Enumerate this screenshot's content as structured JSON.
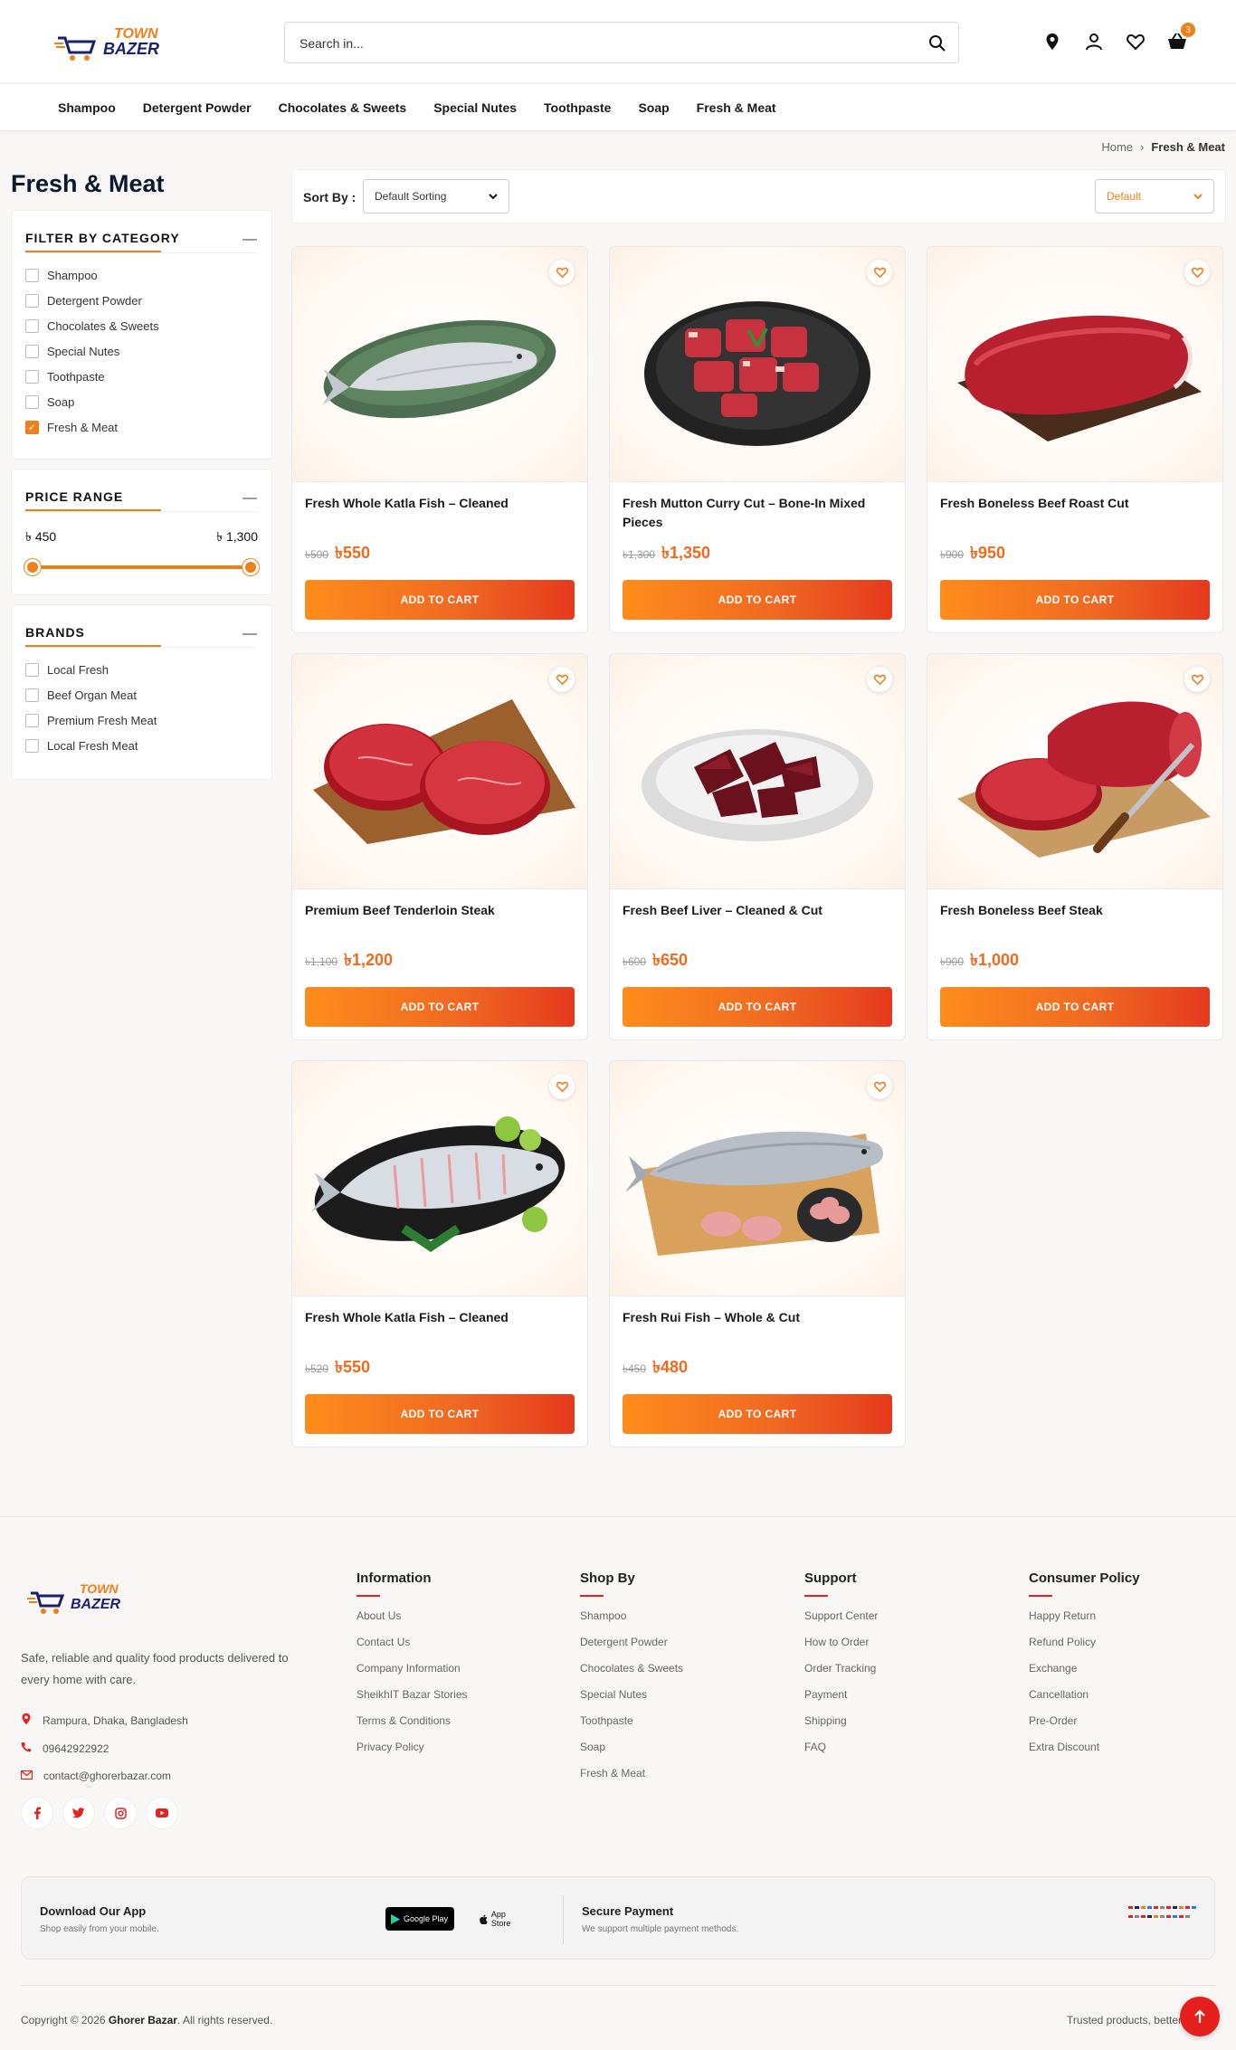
{
  "brand": {
    "line1": "TOWN",
    "line2": "BAZER",
    "accent": "#f07f1a",
    "ink": "#1b1f6e"
  },
  "header": {
    "search_placeholder": "Search in...",
    "cart_count": "3",
    "icons": [
      "location-icon",
      "user-icon",
      "heart-icon",
      "cart-icon"
    ]
  },
  "nav": {
    "categories": [
      "Shampoo",
      "Detergent Powder",
      "Chocolates & Sweets",
      "Special Nutes",
      "Toothpaste",
      "Soap",
      "Fresh & Meat"
    ]
  },
  "breadcrumb": {
    "home": "Home",
    "sep": "›",
    "current": "Fresh & Meat"
  },
  "page": {
    "title": "Fresh & Meat"
  },
  "filters": {
    "category_title": "FILTER BY CATEGORY",
    "categories": [
      {
        "label": "Shampoo",
        "checked": false
      },
      {
        "label": "Detergent Powder",
        "checked": false
      },
      {
        "label": "Chocolates & Sweets",
        "checked": false
      },
      {
        "label": "Special Nutes",
        "checked": false
      },
      {
        "label": "Toothpaste",
        "checked": false
      },
      {
        "label": "Soap",
        "checked": false
      },
      {
        "label": "Fresh & Meat",
        "checked": true
      }
    ],
    "price_title": "PRICE RANGE",
    "price_min": "৳ 450",
    "price_max": "৳ 1,300",
    "brands_title": "BRANDS",
    "brands": [
      {
        "label": "Local Fresh",
        "checked": false
      },
      {
        "label": "Beef Organ Meat",
        "checked": false
      },
      {
        "label": "Premium Fresh Meat",
        "checked": false
      },
      {
        "label": "Local Fresh Meat",
        "checked": false
      }
    ]
  },
  "toolbar": {
    "sort_label": "Sort By :",
    "sort_value": "Default Sorting",
    "view_value": "Default"
  },
  "products": [
    {
      "name": "Fresh Whole Katla Fish – Cleaned",
      "old": "৳500",
      "price": "৳550",
      "cta": "ADD TO CART",
      "kind": "fish-plate"
    },
    {
      "name": "Fresh Mutton Curry Cut – Bone-In Mixed Pieces",
      "old": "৳1,300",
      "price": "৳1,350",
      "cta": "ADD TO CART",
      "kind": "mutton"
    },
    {
      "name": "Fresh Boneless Beef Roast Cut",
      "old": "৳900",
      "price": "৳950",
      "cta": "ADD TO CART",
      "kind": "roast"
    },
    {
      "name": "Premium Beef Tenderloin Steak",
      "old": "৳1,100",
      "price": "৳1,200",
      "cta": "ADD TO CART",
      "kind": "steaks"
    },
    {
      "name": "Fresh Beef Liver – Cleaned & Cut",
      "old": "৳600",
      "price": "৳650",
      "cta": "ADD TO CART",
      "kind": "liver"
    },
    {
      "name": "Fresh Boneless Beef Steak",
      "old": "৳900",
      "price": "৳1,000",
      "cta": "ADD TO CART",
      "kind": "steak-knife"
    },
    {
      "name": "Fresh Whole Katla Fish – Cleaned",
      "old": "৳520",
      "price": "৳550",
      "cta": "ADD TO CART",
      "kind": "fish-black"
    },
    {
      "name": "Fresh Rui Fish – Whole & Cut",
      "old": "৳450",
      "price": "৳480",
      "cta": "ADD TO CART",
      "kind": "fish-board"
    }
  ],
  "footer": {
    "description": "Safe, reliable and quality food products delivered to every home with care.",
    "address": "Rampura, Dhaka, Bangladesh",
    "phone": "09642922922",
    "email": "contact@ghorerbazar.com",
    "socials": [
      "facebook-icon",
      "twitter-icon",
      "instagram-icon",
      "youtube-icon"
    ],
    "columns": [
      {
        "title": "Information",
        "links": [
          "About Us",
          "Contact Us",
          "Company Information",
          "SheikhIT Bazar Stories",
          "Terms & Conditions",
          "Privacy Policy"
        ]
      },
      {
        "title": "Shop By",
        "links": [
          "Shampoo",
          "Detergent Powder",
          "Chocolates & Sweets",
          "Special Nutes",
          "Toothpaste",
          "Soap",
          "Fresh & Meat"
        ]
      },
      {
        "title": "Support",
        "links": [
          "Support Center",
          "How to Order",
          "Order Tracking",
          "Payment",
          "Shipping",
          "FAQ"
        ]
      },
      {
        "title": "Consumer Policy",
        "links": [
          "Happy Return",
          "Refund Policy",
          "Exchange",
          "Cancellation",
          "Pre-Order",
          "Extra Discount"
        ]
      }
    ],
    "app_title": "Download Our App",
    "app_sub": "Shop easily from your mobile.",
    "google_play": "Google Play",
    "app_store": "App Store",
    "pay_title": "Secure Payment",
    "pay_sub": "We support multiple payment methods.",
    "copyright_pre": "Copyright © 2026",
    "copyright_brand": "Ghorer Bazar",
    "copyright_post": ". All rights reserved.",
    "trusted": "Trusted products, better"
  }
}
